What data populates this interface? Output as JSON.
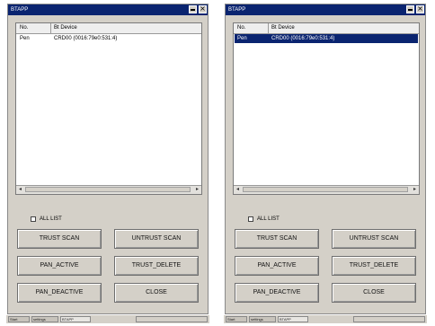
{
  "windows": [
    {
      "title": "BTAPP",
      "list": {
        "header_no": "No.",
        "header_device": "Bt Device",
        "rows": [
          {
            "no": "Pen",
            "device": "CRD00 (0016:79e0:531:4)",
            "selected": false
          }
        ]
      },
      "all_list_label": "ALL LIST",
      "all_list_checked": false,
      "buttons": {
        "trust_scan": "TRUST SCAN",
        "untrust_scan": "UNTRUST SCAN",
        "pan_active": "PAN_ACTIVE",
        "trust_delete": "TRUST_DELETE",
        "pan_deactive": "PAN_DEACTIVE",
        "close": "CLOSE"
      },
      "taskbar": {
        "items": [
          "Start",
          "settings",
          "BTAPP"
        ],
        "active_item": "BTAPP"
      }
    },
    {
      "title": "BTAPP",
      "list": {
        "header_no": "No.",
        "header_device": "Bt Device",
        "rows": [
          {
            "no": "Pen",
            "device": "CRD00 (0016:79e0:531:4)",
            "selected": true
          }
        ]
      },
      "all_list_label": "ALL LIST",
      "all_list_checked": false,
      "buttons": {
        "trust_scan": "TRUST SCAN",
        "untrust_scan": "UNTRUST SCAN",
        "pan_active": "PAN_ACTIVE",
        "trust_delete": "TRUST_DELETE",
        "pan_deactive": "PAN_DEACTIVE",
        "close": "CLOSE"
      },
      "taskbar": {
        "items": [
          "Start",
          "settings",
          "BTAPP"
        ],
        "active_item": "BTAPP"
      }
    }
  ],
  "icons": {
    "minimize": "minimize-icon",
    "close": "close-icon",
    "scroll_left": "scroll-left-arrow-icon",
    "scroll_right": "scroll-right-arrow-icon"
  },
  "colors": {
    "titlebar": "#0a2470",
    "window_bg": "#d4d0c8",
    "selection": "#0a2470"
  }
}
